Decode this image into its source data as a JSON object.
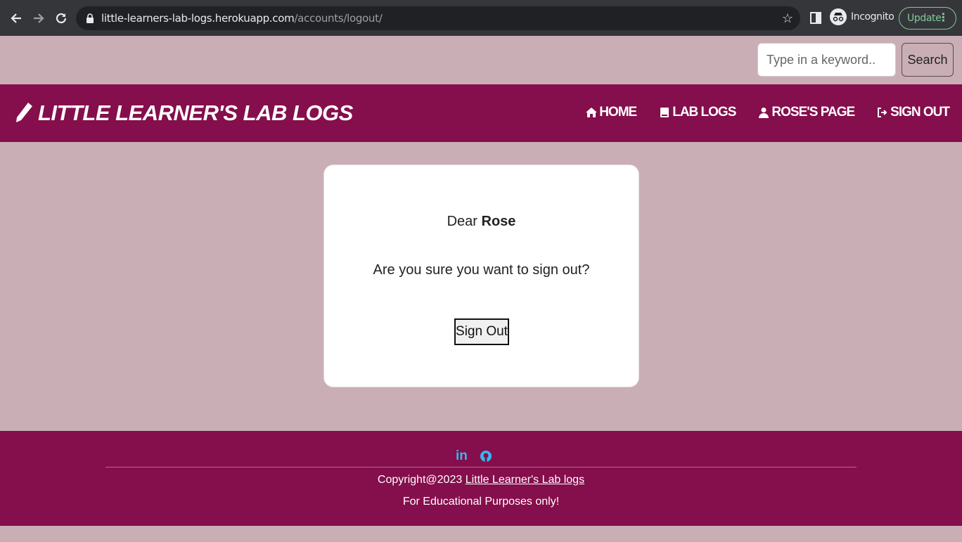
{
  "browser": {
    "url_host": "little-learners-lab-logs.herokuapp.com",
    "url_path": "/accounts/logout/",
    "profile_label": "Incognito",
    "update_label": "Update",
    "icons": [
      "back-arrow-icon",
      "forward-arrow-icon",
      "reload-icon",
      "lock-icon",
      "star-icon",
      "side-panel-icon",
      "incognito-icon",
      "more-vertical-icon"
    ]
  },
  "search": {
    "placeholder": "Type in a keyword..",
    "button_label": "Search"
  },
  "navbar": {
    "brand": "LITTLE LEARNER'S LAB LOGS",
    "brand_icon": "pencil-icon",
    "links": [
      {
        "label": "HOME",
        "icon": "home-icon"
      },
      {
        "label": "LAB LOGS",
        "icon": "book-icon"
      },
      {
        "label": "ROSE'S PAGE",
        "icon": "user-icon"
      },
      {
        "label": "SIGN OUT",
        "icon": "sign-out-icon"
      }
    ]
  },
  "logout": {
    "greeting_prefix": "Dear",
    "username": "Rose",
    "question": "Are you sure you want to sign out?",
    "button_label": "Sign Out"
  },
  "footer": {
    "socials": [
      "linkedin-icon",
      "github-icon"
    ],
    "copyright_prefix": "Copyright@2023",
    "copyright_link": "Little Learner's Lab logs",
    "purpose": "For Educational Purposes only!"
  },
  "colors": {
    "page_bg": "#c9aeb6",
    "brand": "#850e4c",
    "social_icon": "#35b8f0",
    "update_green": "#81c995"
  }
}
